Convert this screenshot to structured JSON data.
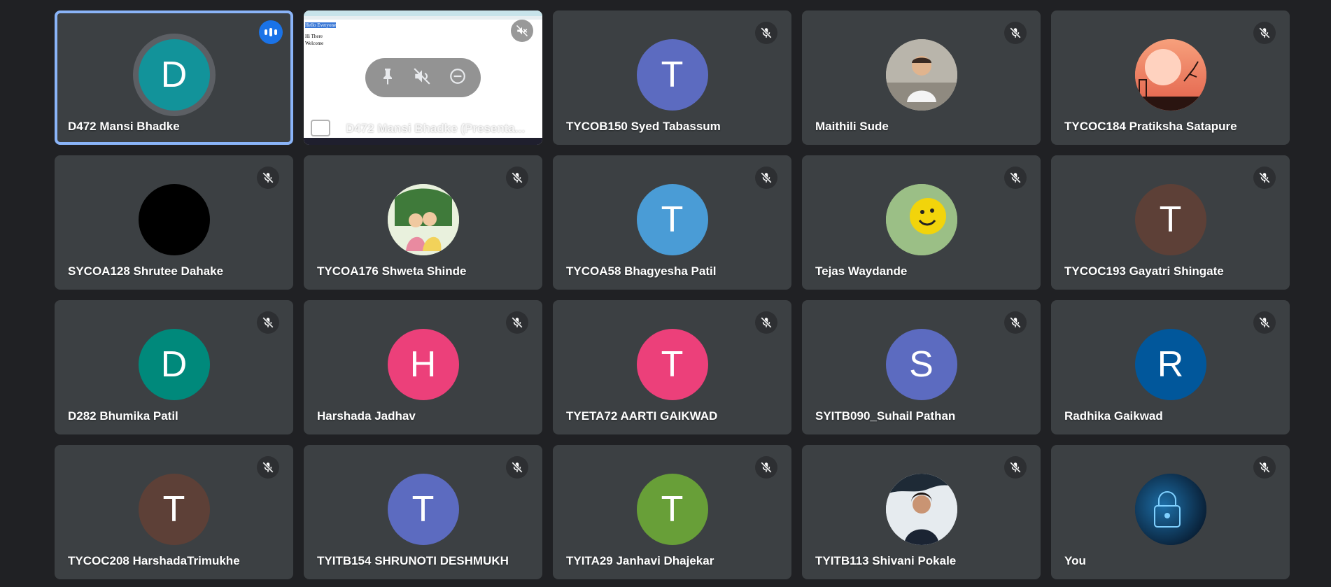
{
  "tiles": [
    {
      "name": "D472 Mansi Bhadke",
      "initial": "D",
      "color": "#12939a",
      "avatar": "letter",
      "speaking": true
    },
    {
      "name": "D472 Mansi Bhadke (Presenta...",
      "presentation": true,
      "doc_lines": [
        "Hello Everyone",
        "Hi There",
        "Welcome"
      ]
    },
    {
      "name": "TYCOB150 Syed Tabassum",
      "initial": "T",
      "color": "#5c6bc0",
      "avatar": "letter"
    },
    {
      "name": "Maithili Sude",
      "avatar": "photo-person",
      "color": "#c9c4b8"
    },
    {
      "name": "TYCOC184 Pratiksha Satapure",
      "avatar": "photo-moon",
      "color": "#f28b6b"
    },
    {
      "name": "SYCOA128 Shrutee Dahake",
      "avatar": "black",
      "color": "#000000"
    },
    {
      "name": "TYCOA176 Shweta Shinde",
      "avatar": "photo-art",
      "color": "#d9e8c8"
    },
    {
      "name": "TYCOA58 Bhagyesha Patil",
      "initial": "T",
      "color": "#4a9cd6",
      "avatar": "letter"
    },
    {
      "name": "Tejas Waydande",
      "avatar": "photo-smiley",
      "color": "#a8c58d"
    },
    {
      "name": "TYCOC193 Gayatri Shingate",
      "initial": "T",
      "color": "#5d4037",
      "avatar": "letter"
    },
    {
      "name": "D282 Bhumika Patil",
      "initial": "D",
      "color": "#00897b",
      "avatar": "letter"
    },
    {
      "name": "Harshada Jadhav",
      "initial": "H",
      "color": "#ec407a",
      "avatar": "letter"
    },
    {
      "name": "TYETA72 AARTI GAIKWAD",
      "initial": "T",
      "color": "#ec407a",
      "avatar": "letter"
    },
    {
      "name": "SYITB090_Suhail Pathan",
      "initial": "S",
      "color": "#5c6bc0",
      "avatar": "letter"
    },
    {
      "name": "Radhika Gaikwad",
      "initial": "R",
      "color": "#01579b",
      "avatar": "letter"
    },
    {
      "name": "TYCOC208 HarshadaTrimukhe",
      "initial": "T",
      "color": "#5d4037",
      "avatar": "letter"
    },
    {
      "name": "TYITB154 SHRUNOTI DESHMUKH",
      "initial": "T",
      "color": "#5c6bc0",
      "avatar": "letter"
    },
    {
      "name": "TYITA29 Janhavi Dhajekar",
      "initial": "T",
      "color": "#689f38",
      "avatar": "letter"
    },
    {
      "name": "TYITB113 Shivani Pokale",
      "avatar": "photo-girl",
      "color": "#dfe6ec"
    },
    {
      "name": "You",
      "avatar": "photo-lock",
      "color": "#0b2a4a"
    }
  ]
}
